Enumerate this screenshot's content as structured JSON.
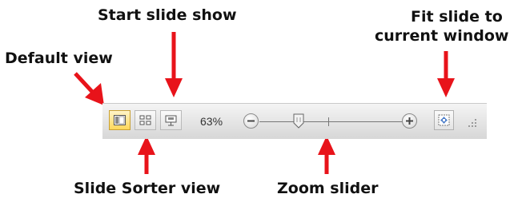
{
  "annotations": {
    "start_slide_show": "Start slide show",
    "fit_slide_line1": "Fit slide to",
    "fit_slide_line2": "current window",
    "default_view": "Default view",
    "slide_sorter_view": "Slide Sorter view",
    "zoom_slider": "Zoom slider"
  },
  "status_bar": {
    "zoom_percent": "63%",
    "zoom_level": 0.63,
    "views": [
      {
        "name": "Normal",
        "icon": "normal-view-icon",
        "active": true
      },
      {
        "name": "Slide Sorter",
        "icon": "slide-sorter-icon",
        "active": false
      },
      {
        "name": "Slide Show",
        "icon": "slide-show-icon",
        "active": false
      }
    ],
    "icons": [
      "zoom-out-icon",
      "zoom-in-icon",
      "fit-to-window-icon",
      "resize-grip-icon"
    ]
  },
  "colors": {
    "arrow": "#e8131a",
    "active_view": "#ffd75a"
  }
}
